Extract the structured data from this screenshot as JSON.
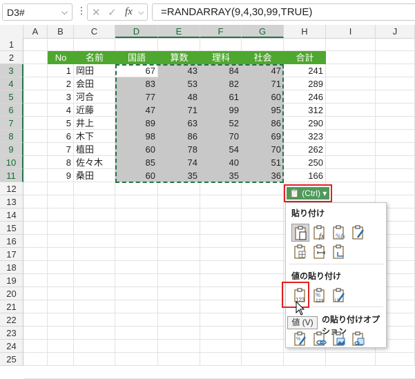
{
  "formula_bar": {
    "name_box": "D3#",
    "name_box_arrow": "⌵",
    "dots": "⋮",
    "cancel_icon": "✕",
    "enter_icon": "✓",
    "fx_label": "fx",
    "formula": "=RANDARRAY(9,4,30,99,TRUE)"
  },
  "columns": [
    "A",
    "B",
    "C",
    "D",
    "E",
    "F",
    "G",
    "H",
    "I",
    "J"
  ],
  "rows": [
    "1",
    "2",
    "3",
    "4",
    "5",
    "6",
    "7",
    "8",
    "9",
    "10",
    "11",
    "12",
    "13",
    "14",
    "15",
    "16",
    "17",
    "18",
    "19",
    "20",
    "21",
    "22",
    "23",
    "24",
    "25"
  ],
  "table": {
    "headers": [
      "No",
      "名前",
      "国語",
      "算数",
      "理科",
      "社会",
      "合計"
    ],
    "rows": [
      {
        "no": "1",
        "name": "岡田",
        "scores": [
          "67",
          "43",
          "84",
          "47"
        ],
        "total": "241"
      },
      {
        "no": "2",
        "name": "会田",
        "scores": [
          "83",
          "53",
          "82",
          "71"
        ],
        "total": "289"
      },
      {
        "no": "3",
        "name": "河合",
        "scores": [
          "77",
          "48",
          "61",
          "60"
        ],
        "total": "246"
      },
      {
        "no": "4",
        "name": "近藤",
        "scores": [
          "47",
          "71",
          "99",
          "95"
        ],
        "total": "312"
      },
      {
        "no": "5",
        "name": "井上",
        "scores": [
          "89",
          "63",
          "52",
          "86"
        ],
        "total": "290"
      },
      {
        "no": "6",
        "name": "木下",
        "scores": [
          "98",
          "86",
          "70",
          "69"
        ],
        "total": "323"
      },
      {
        "no": "7",
        "name": "植田",
        "scores": [
          "60",
          "78",
          "54",
          "70"
        ],
        "total": "262"
      },
      {
        "no": "8",
        "name": "佐々木",
        "scores": [
          "85",
          "74",
          "40",
          "51"
        ],
        "total": "250"
      },
      {
        "no": "9",
        "name": "桑田",
        "scores": [
          "60",
          "35",
          "35",
          "36"
        ],
        "total": "166"
      }
    ]
  },
  "paste_button": {
    "label": "(Ctrl)",
    "arrow": "▾"
  },
  "paste_menu": {
    "section_paste": "貼り付け",
    "section_values": "値の貼り付け",
    "section_other_visible": "の貼り付けオプション",
    "tooltip": "値 (V)"
  },
  "colors": {
    "header_green": "#4ea72e",
    "selection_green": "#217346",
    "highlight_red": "#e02020",
    "gray_fill": "#c8c8c8"
  }
}
